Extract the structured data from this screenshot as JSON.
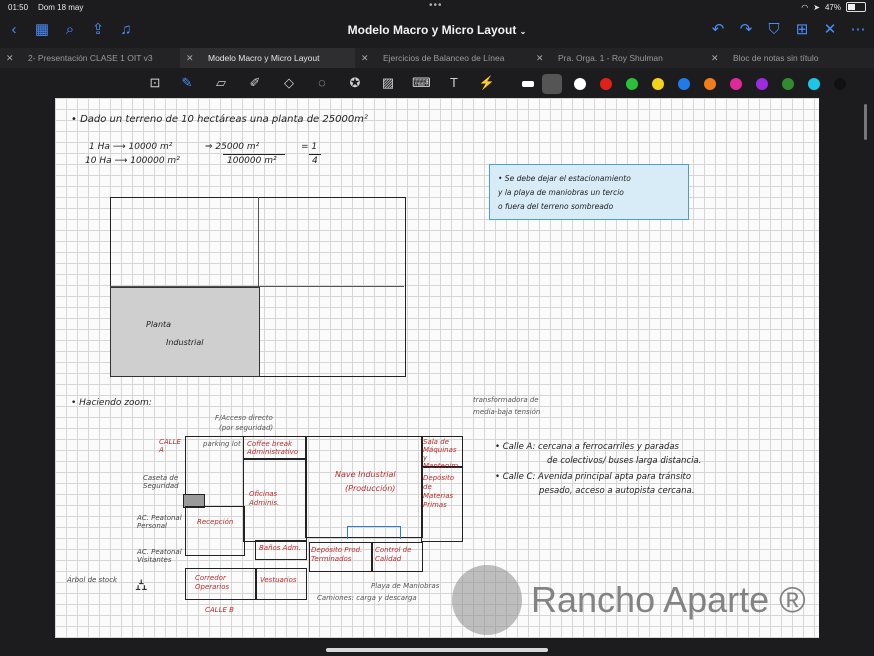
{
  "status_bar": {
    "time": "01:50",
    "date": "Dom 18 may",
    "battery": "47%"
  },
  "document": {
    "title": "Modelo Macro y Micro Layout"
  },
  "tabs": [
    {
      "label": "2- Presentación CLASE 1 OIT v3"
    },
    {
      "label": "Modelo Macro y Micro Layout"
    },
    {
      "label": "Ejercicios de Balanceo de Línea"
    },
    {
      "label": "Pra. Orga. 1 - Roy Shulman"
    },
    {
      "label": "Bloc de notas sin título"
    }
  ],
  "palette": {
    "colors": [
      "#ffffff",
      "#555555",
      "#ffffff",
      "#e0201b",
      "#2bc03a",
      "#f2d51a",
      "#1e7be8",
      "#f07d1a",
      "#e0289a",
      "#9b2ae0",
      "#2f8c2f",
      "#19c8e6",
      "#111111"
    ]
  },
  "notes": {
    "line1": "• Dado un terreno de 10 hectáreas una planta de 25000m²",
    "calc_a": "1 Ha ⟶ 10000 m²",
    "calc_b": "10 Ha ⟶ 100000 m²",
    "calc_c": "⇒ 25000 m²",
    "calc_d": "100000 m²",
    "calc_e": "= 1",
    "calc_f": "4",
    "box_line1": "• Se debe dejar el estacionamiento",
    "box_line2": "y la playa de maniobras un tercio",
    "box_line3": "o fuera del terreno sombreado",
    "planta_1": "Planta",
    "planta_2": "Industrial",
    "zoom": "• Haciendo zoom:",
    "acceso": "F/Acceso directo",
    "acceso2": "(por seguridad)",
    "transforma": "transformadora de",
    "transforma2": "media-baja tensión",
    "calle_a_note1": "• Calle A: cercana a ferrocarriles y paradas",
    "calle_a_note2": "de colectivos/ buses larga distancia.",
    "calle_c_note1": "• Calle C: Avenida principal apta para tránsito",
    "calle_c_note2": "pesado, acceso a autopista cercana.",
    "calle_a": "CALLE A",
    "calle_b": "CALLE B",
    "parking": "parking lot",
    "caseta": "Caseta de Seguridad",
    "acc_peatonal_1": "AC. Peatonal Personal",
    "acc_peatonal_2": "AC. Peatonal Visitantes",
    "arbol": "Árbol de stock",
    "coffee": "Coffee break Administrativo",
    "oficinas": "Oficinas Adminis.",
    "recepcion": "Recepción",
    "banos": "Baños Adm.",
    "corredor": "Corredor Operarios",
    "vestuarios": "Vestuarios",
    "nave": "Nave Industrial",
    "produccion": "(Producción)",
    "sala": "Sala de Máquinas y Mantenim.",
    "deposito_mp": "Depósito de Materias Primas",
    "deposito_pt": "Depósito Prod. Terminados",
    "control": "Control de Calidad",
    "playa": "Playa de Maniobras",
    "camiones": "Camiones: carga y descarga"
  },
  "watermark": {
    "text": "Rancho Aparte ®"
  }
}
